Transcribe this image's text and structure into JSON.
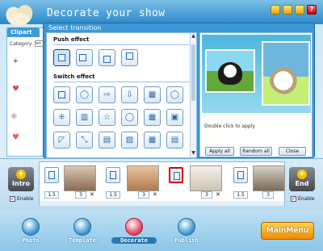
{
  "app": {
    "title": "Decorate your show",
    "help_label": "?"
  },
  "clipart_panel": {
    "tab_label": "Clipart",
    "category_label": "Category",
    "category_value": "arr"
  },
  "dialog": {
    "title": "Select transition",
    "push_section": "Push effect",
    "switch_section": "Switch effect",
    "double_click_hint": "Double click to apply",
    "apply_all": "Apply all",
    "random_all": "Random all",
    "close": "Close"
  },
  "timeline": {
    "intro_label": "Intro",
    "end_label": "End",
    "enable_label": "Enable",
    "durations": [
      "1.5",
      "1.5",
      "1.5",
      "1.5"
    ],
    "photo_durations": [
      "3",
      "3",
      "3",
      "3"
    ],
    "photo_numbers": [
      "1",
      "2",
      "3",
      "4"
    ]
  },
  "nav": {
    "items": [
      "Photo",
      "Template",
      "Decorate",
      "Publish"
    ],
    "active": "Decorate",
    "main_menu": "MainMenu"
  },
  "colors": {
    "accent": "#3d98d6",
    "selected_outline": "#d80000",
    "main_menu": "#f5a800"
  }
}
